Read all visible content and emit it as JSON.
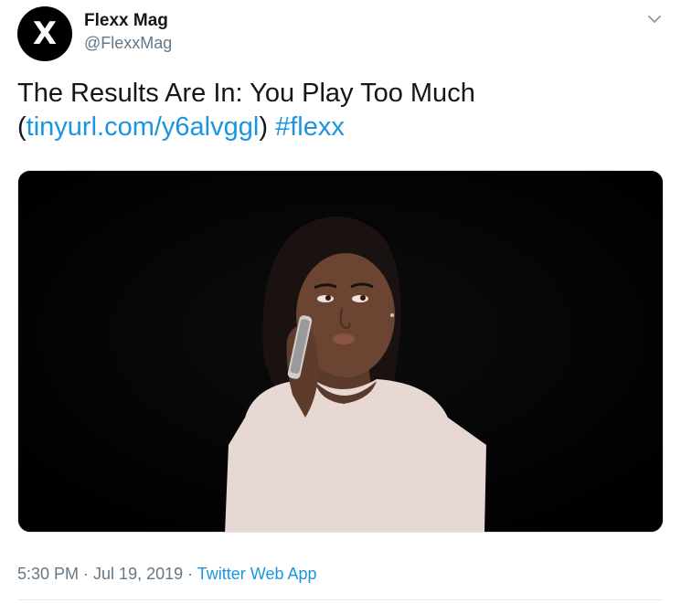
{
  "author": {
    "avatar_letter": "X",
    "name": "Flexx Mag",
    "handle": "@FlexxMag"
  },
  "tweet": {
    "text_main": "The Results Are In: You Play Too Much",
    "paren_open": "(",
    "link": "tinyurl.com/y6alvggl",
    "paren_close": ")",
    "hashtag": "#flexx"
  },
  "media": {
    "description_icon": "photo"
  },
  "footer": {
    "time": "5:30 PM",
    "sep1": " · ",
    "date": "Jul 19, 2019",
    "sep2": " · ",
    "source": "Twitter Web App"
  },
  "colors": {
    "link": "#1b95e0",
    "secondary": "#657786",
    "text": "#14171a"
  },
  "icons": [
    "chevron-down-icon"
  ]
}
